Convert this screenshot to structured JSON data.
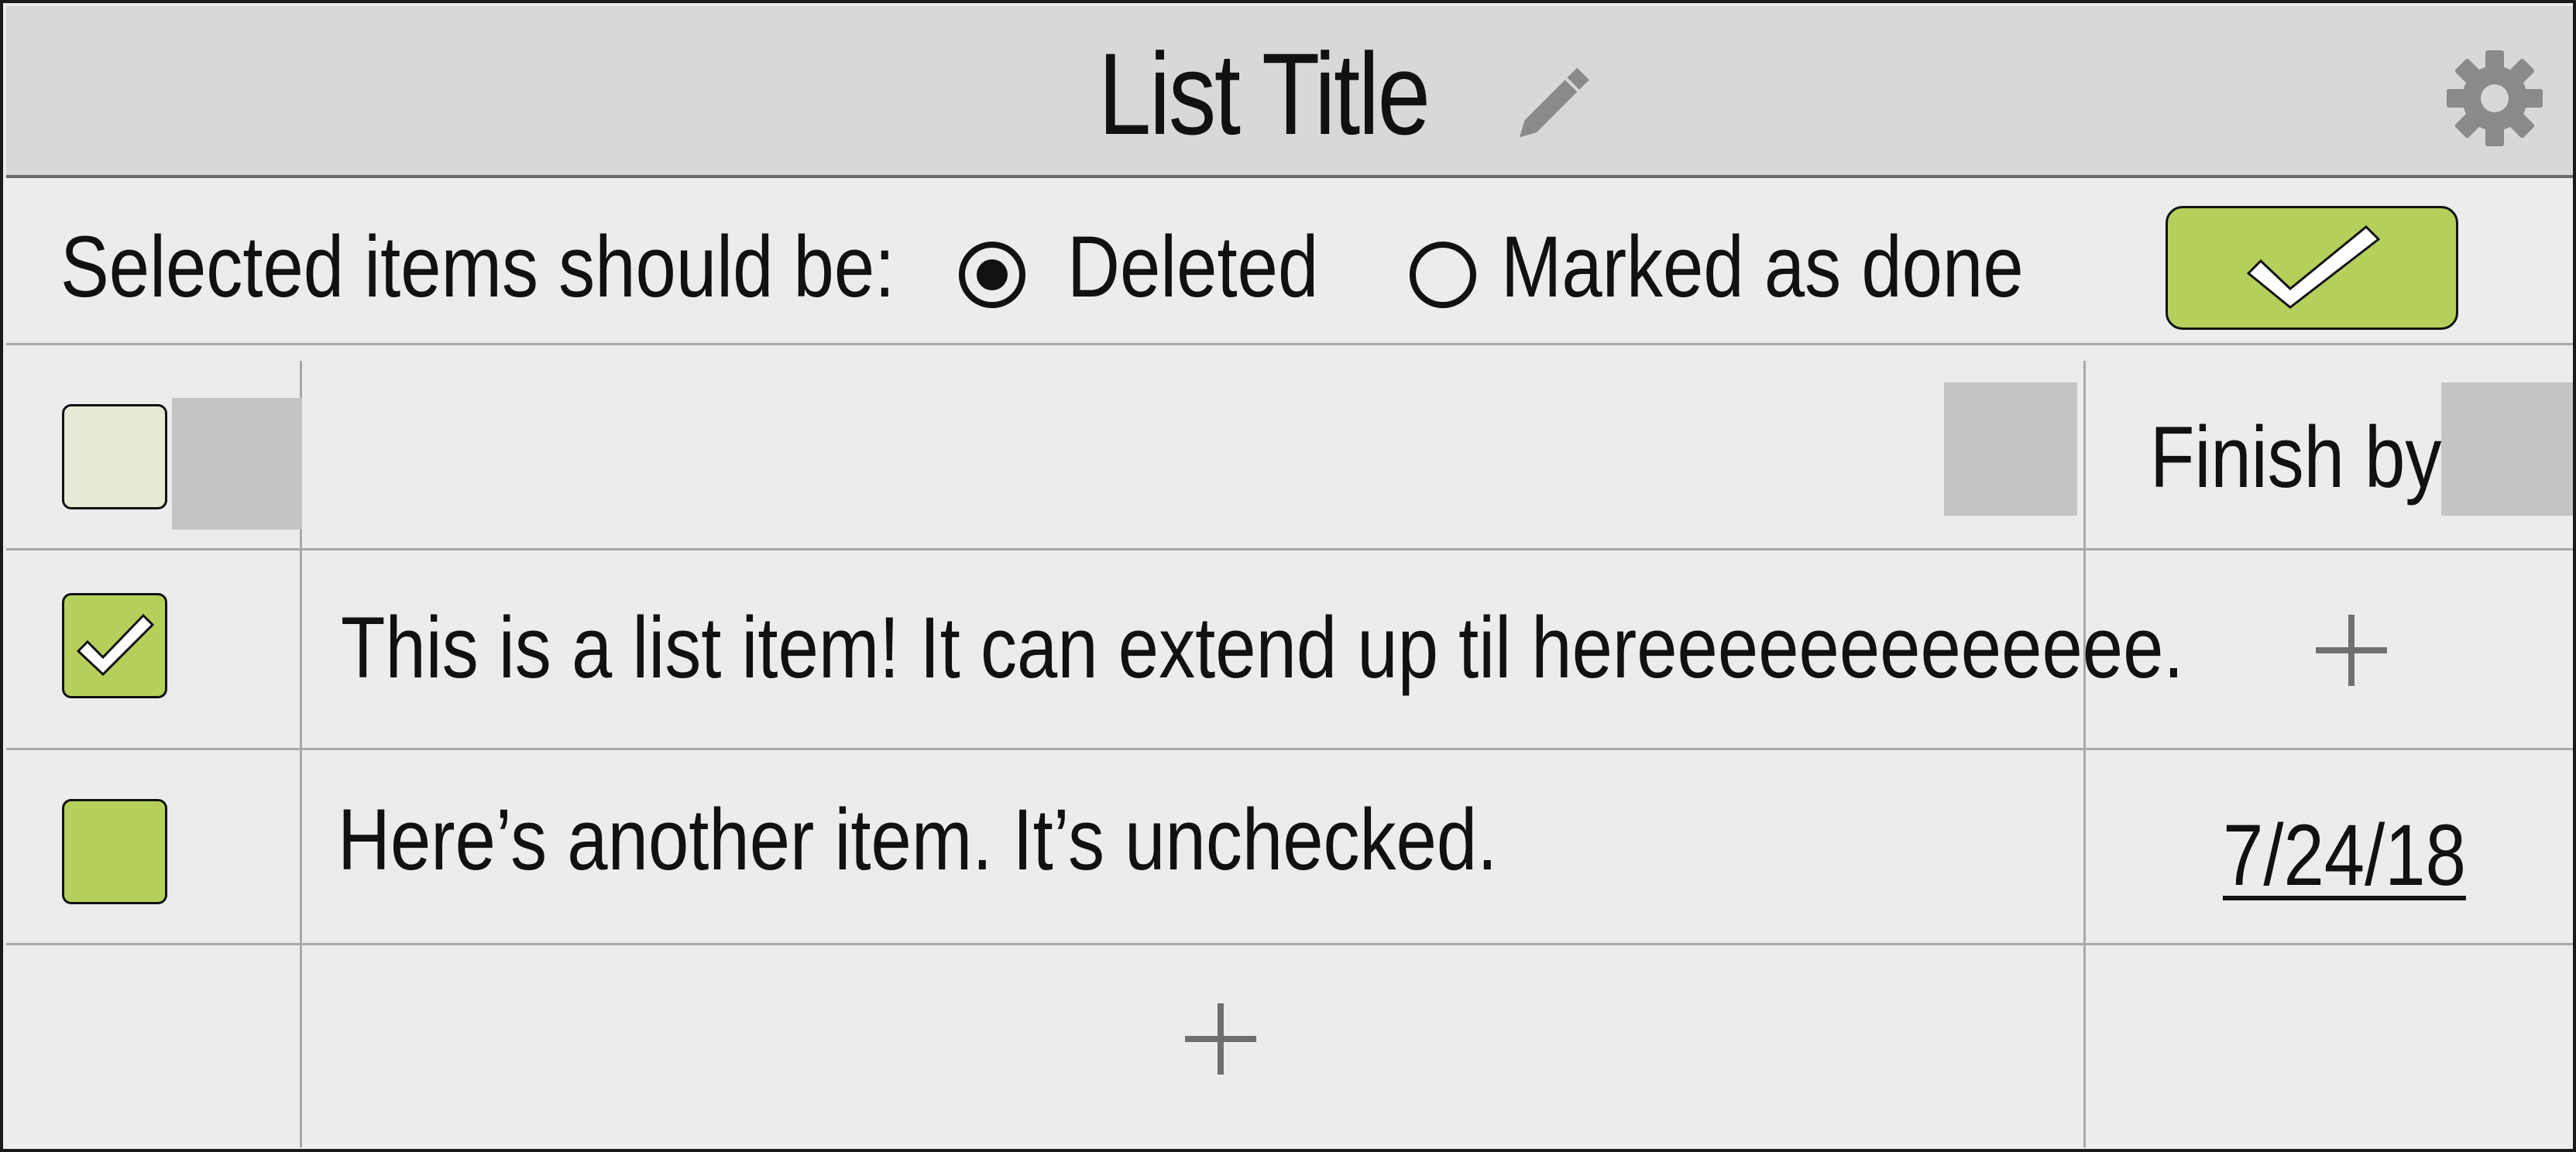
{
  "title": {
    "text": "List Title",
    "edit_icon": "pencil-icon",
    "settings_icon": "gear-icon"
  },
  "options": {
    "label": "Selected items should be:",
    "choices": [
      {
        "label": "Deleted",
        "selected": true
      },
      {
        "label": "Marked as done",
        "selected": false
      }
    ],
    "confirm_icon": "checkmark-icon"
  },
  "header_row": {
    "finish_label": "Finish by:"
  },
  "items": [
    {
      "text": "This is a list item! It can extend up til hereeeeeeeeeeeee.",
      "checked": true,
      "due": null,
      "due_action_icon": "plus-icon"
    },
    {
      "text": "Here’s another item. It’s unchecked.",
      "checked": false,
      "due": "7/24/18"
    }
  ],
  "add_item_icon": "plus-icon",
  "colors": {
    "accent": "#b5d05a",
    "titlebar_bg": "#d8d8d8",
    "page_bg": "#ececec",
    "placeholder": "#c4c4c4",
    "grid": "#a8a8a8",
    "header_checkbox_bg": "#e4ead4"
  }
}
